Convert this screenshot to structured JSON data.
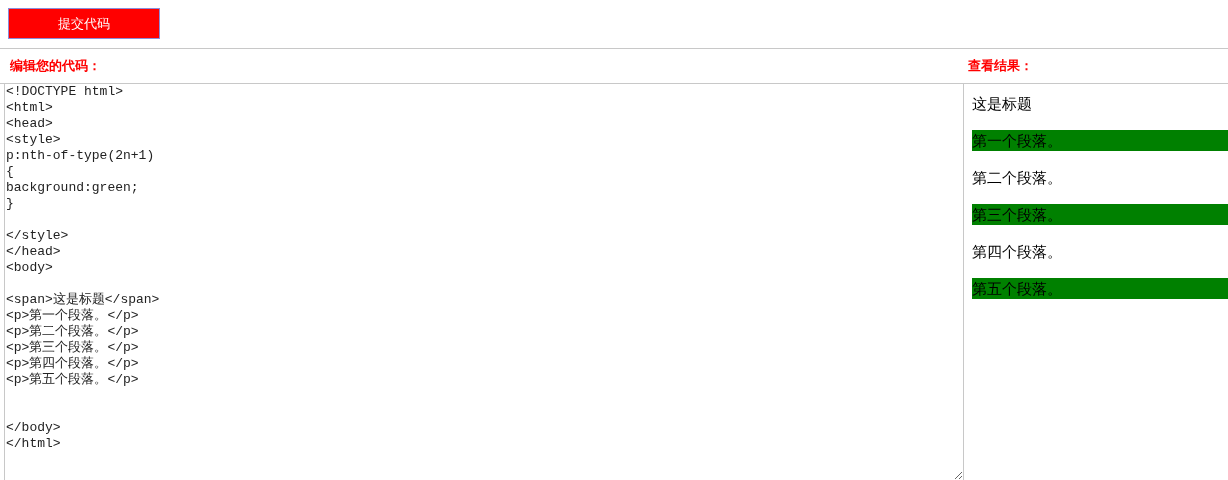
{
  "submit_button": "提交代码",
  "editor": {
    "label": "编辑您的代码：",
    "code": "<!DOCTYPE html>\n<html>\n<head>\n<style>\np:nth-of-type(2n+1)\n{\nbackground:green;\n}\n\n</style>\n</head>\n<body>\n\n<span>这是标题</span>\n<p>第一个段落。</p>\n<p>第二个段落。</p>\n<p>第三个段落。</p>\n<p>第四个段落。</p>\n<p>第五个段落。</p>\n\n\n</body>\n</html>"
  },
  "result": {
    "label": "查看结果：",
    "heading": "这是标题",
    "paragraphs": [
      {
        "text": "第一个段落。",
        "highlighted": true
      },
      {
        "text": "第二个段落。",
        "highlighted": false
      },
      {
        "text": "第三个段落。",
        "highlighted": true
      },
      {
        "text": "第四个段落。",
        "highlighted": false
      },
      {
        "text": "第五个段落。",
        "highlighted": true
      }
    ]
  }
}
